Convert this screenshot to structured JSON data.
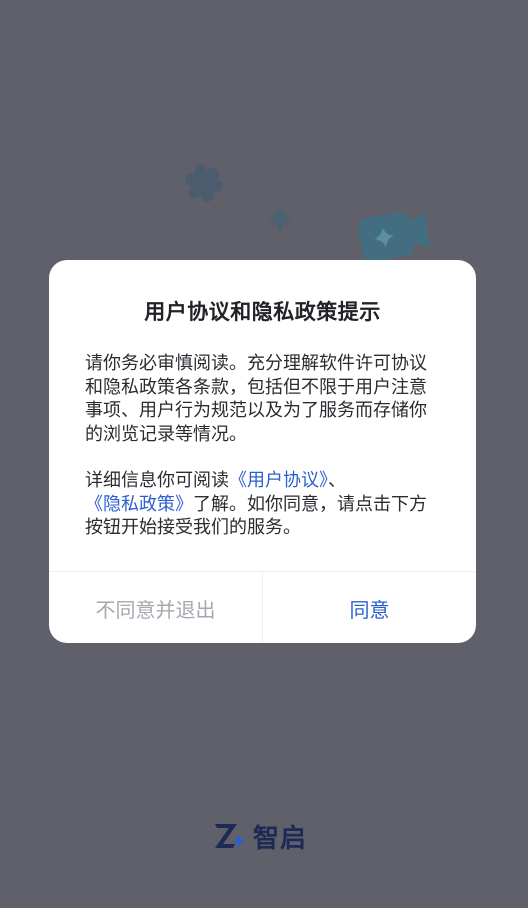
{
  "dialog": {
    "title": "用户协议和隐私政策提示",
    "paragraph1": "请你务必审慎阅读。充分理解软件许可协议和隐私政策各条款，包括但不限于用户注意事项、用户行为规范以及为了服务而存储你的浏览记录等情况。",
    "paragraph2_prefix": "详细信息你可阅读",
    "user_agreement_link": "《用户协议》",
    "separator": "、",
    "privacy_policy_link": "《隐私政策》",
    "paragraph2_suffix": "了解。如你同意，请点击下方按钮开始接受我们的服务。",
    "decline_label": "不同意并退出",
    "agree_label": "同意"
  },
  "brand": {
    "name": "智启"
  },
  "colors": {
    "overlay_background": "#5f6069",
    "dialog_background": "#ffffff",
    "link": "#2b5fd0",
    "decline_text": "#a4a8b1",
    "brand_text": "#1c2a55"
  }
}
